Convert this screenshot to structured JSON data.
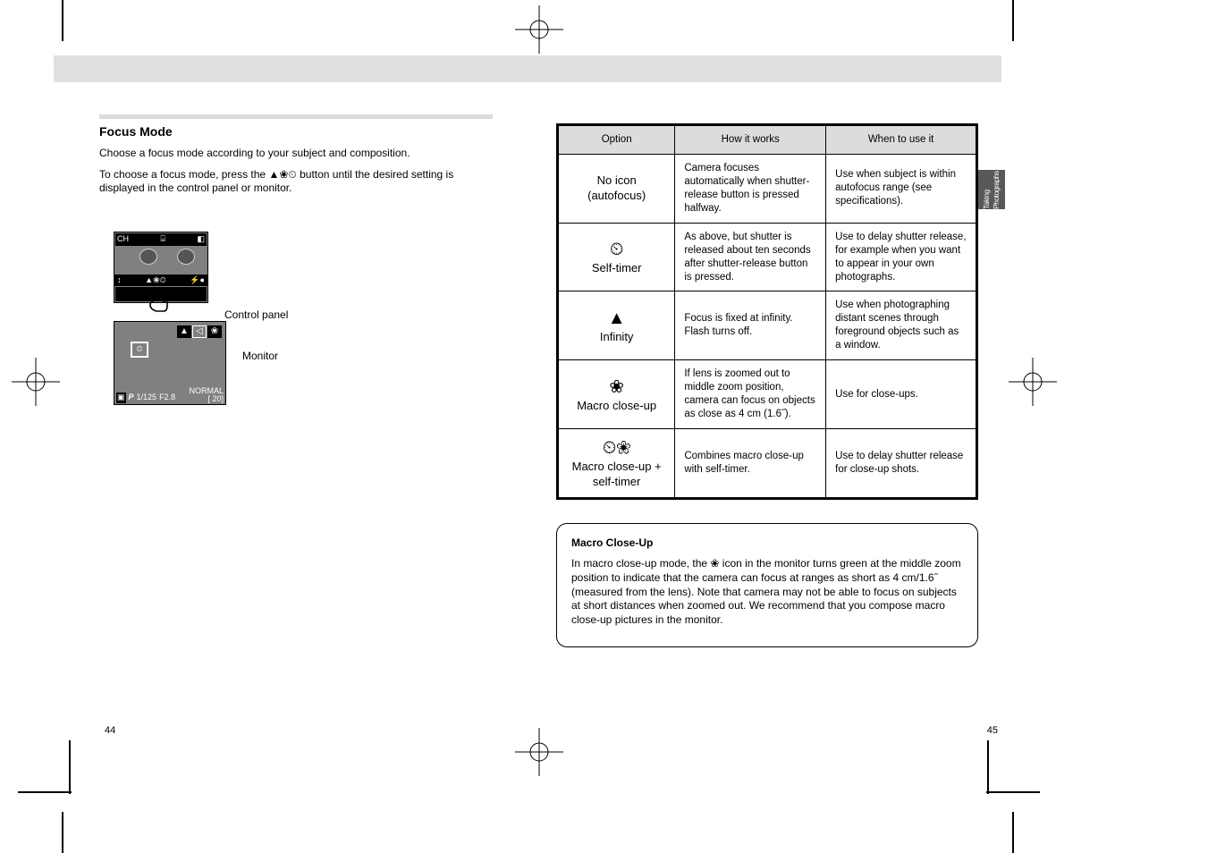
{
  "page": {
    "header_thin_label": "Taking Photographs",
    "sidebar_tab": "Taking Photographs",
    "page_left": "44",
    "page_right": "45"
  },
  "left": {
    "title": "Focus Mode",
    "p1": "Choose a focus mode according to your subject and composition.",
    "icon_seq_label": "To choose a focus mode, press the ",
    "icon_seq_tail": " button until the desired setting is displayed in the control panel or monitor.",
    "cp_label": "Control panel",
    "monitor_label": "Monitor"
  },
  "lcd1": {
    "top_left": "CH",
    "top_mid": "⌸",
    "top_right": "◧",
    "bottom_left": "↕",
    "bottom_mid": "▲❀⏲",
    "bottom_right": "⚡●"
  },
  "lcd2": {
    "tiles": [
      "▲",
      "◁",
      "❀"
    ],
    "badge": "⏲",
    "bl1": "P",
    "bl2": "1/125",
    "bl3": "F2.8",
    "br_top": "NORMAL",
    "br_bot": "[  20]"
  },
  "table": {
    "h1": "Option",
    "h2": "How it works",
    "h3": "When to use it",
    "r1": {
      "opt": "No icon\n(autofocus)",
      "how": "Camera focuses automatically when shutter-release button is pressed halfway.",
      "use": "Use when subject is within autofocus range (see specifications)."
    },
    "r2": {
      "opt_icon": "⏲",
      "opt_text": "Self-timer",
      "how": "As above, but shutter is released about ten seconds after shutter-release button is pressed.",
      "use": "Use to delay shutter release, for example when you want to appear in your own photographs."
    },
    "r3": {
      "opt_icon": "▲",
      "opt_text": "Infinity",
      "how": "Focus is fixed at infinity.  Flash turns off.",
      "use": "Use when photographing distant scenes through foreground objects such as a window."
    },
    "r4": {
      "opt_icon": "❀",
      "opt_text": "Macro close-up",
      "how": "If lens is zoomed out to middle zoom position, camera can focus on objects as close as 4 cm (1.6˝).",
      "use": "Use for close-ups."
    },
    "r5": {
      "opt_icon": "⏲❀",
      "opt_text": "Macro close-up + self-timer",
      "how": "Combines macro close-up with self-timer.",
      "use": "Use to delay shutter release for close-up shots."
    }
  },
  "note": {
    "title": "Macro Close-Up",
    "body": "In macro close-up mode, the ❀ icon in the monitor turns green at the middle zoom position to indicate that the camera can focus at ranges as short as 4 cm/1.6˝ (measured from the lens).  Note that camera may not be able to focus on subjects at short distances when zoomed out.  We recommend that you compose macro close-up pictures in the monitor."
  }
}
